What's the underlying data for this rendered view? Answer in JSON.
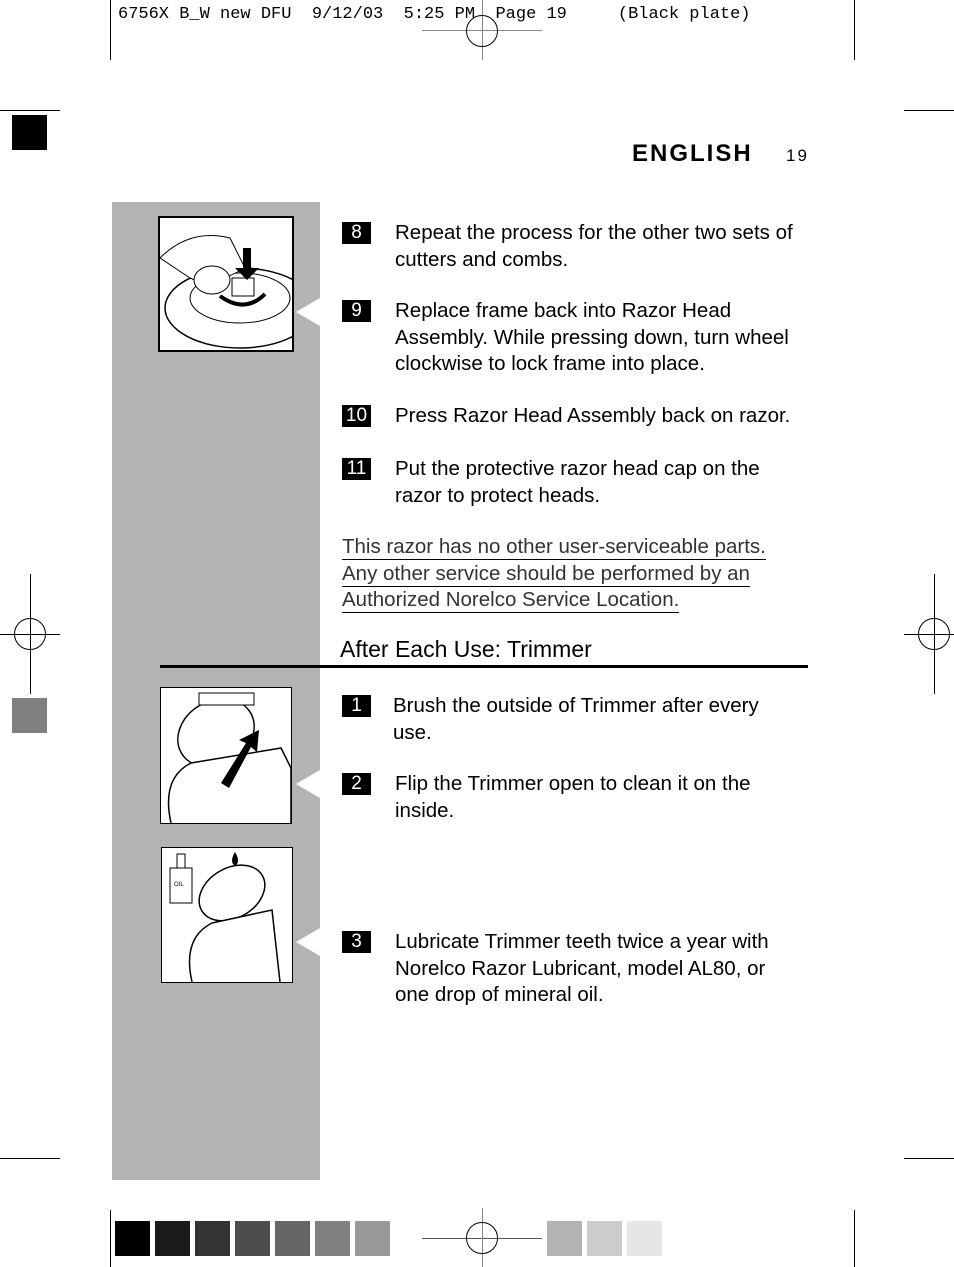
{
  "slug": "6756X B_W new DFU  9/12/03  5:25 PM  Page 19     (Black plate)",
  "header": {
    "language": "ENGLISH",
    "page_number": "19"
  },
  "steps_top": [
    {
      "num": "8",
      "text": "Repeat the process for the other two sets of cutters and combs."
    },
    {
      "num": "9",
      "text": "Replace frame back into Razor Head Assembly. While pressing down, turn wheel clockwise to lock frame into place."
    },
    {
      "num": "10",
      "text": "Press Razor Head Assembly back on razor."
    },
    {
      "num": "11",
      "text": "Put the protective razor head cap on the razor to protect heads."
    }
  ],
  "note": [
    "This razor has no other user-serviceable parts.",
    "Any other service should be performed by an",
    "Authorized Norelco Service Location."
  ],
  "section_title": "After Each Use: Trimmer",
  "steps_trimmer": [
    {
      "num": "1",
      "text": "Brush the outside of Trimmer after every use."
    },
    {
      "num": "2",
      "text": "Flip the Trimmer open to clean it on the inside."
    },
    {
      "num": "3",
      "text": "Lubricate Trimmer teeth twice a year with Norelco Razor Lubricant, model AL80, or one drop of mineral oil."
    }
  ],
  "figure_label": "OIL",
  "swatches": [
    "#000000",
    "#1a1a1a",
    "#333333",
    "#4d4d4d",
    "#666666",
    "#808080",
    "#999999",
    "#b3b3b3",
    "#cccccc",
    "#e6e6e6"
  ]
}
